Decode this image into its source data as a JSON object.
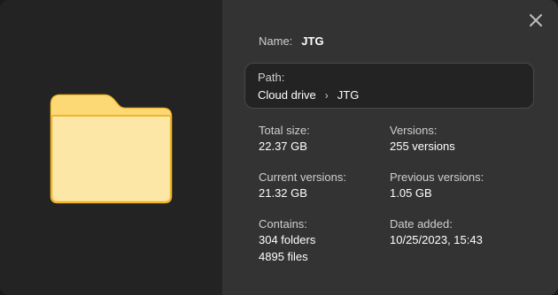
{
  "dialog": {
    "name_label": "Name:",
    "name_value": "JTG",
    "path": {
      "label": "Path:",
      "crumbs": [
        "Cloud drive",
        "JTG"
      ],
      "separator": "›"
    },
    "info": {
      "total_size": {
        "label": "Total size:",
        "value": "22.37 GB"
      },
      "versions": {
        "label": "Versions:",
        "value": "255 versions"
      },
      "current_versions": {
        "label": "Current versions:",
        "value": "21.32 GB"
      },
      "previous_versions": {
        "label": "Previous versions:",
        "value": "1.05 GB"
      },
      "contains": {
        "label": "Contains:",
        "folders": "304 folders",
        "files": "4895 files"
      },
      "date_added": {
        "label": "Date added:",
        "value": "10/25/2023, 15:43"
      }
    }
  },
  "icons": {
    "folder": "folder-icon",
    "close": "close-icon"
  },
  "colors": {
    "left_pane_bg": "#232323",
    "right_pane_bg": "#333333",
    "folder_fill": "#fde7a6",
    "folder_stroke": "#f0b429"
  }
}
